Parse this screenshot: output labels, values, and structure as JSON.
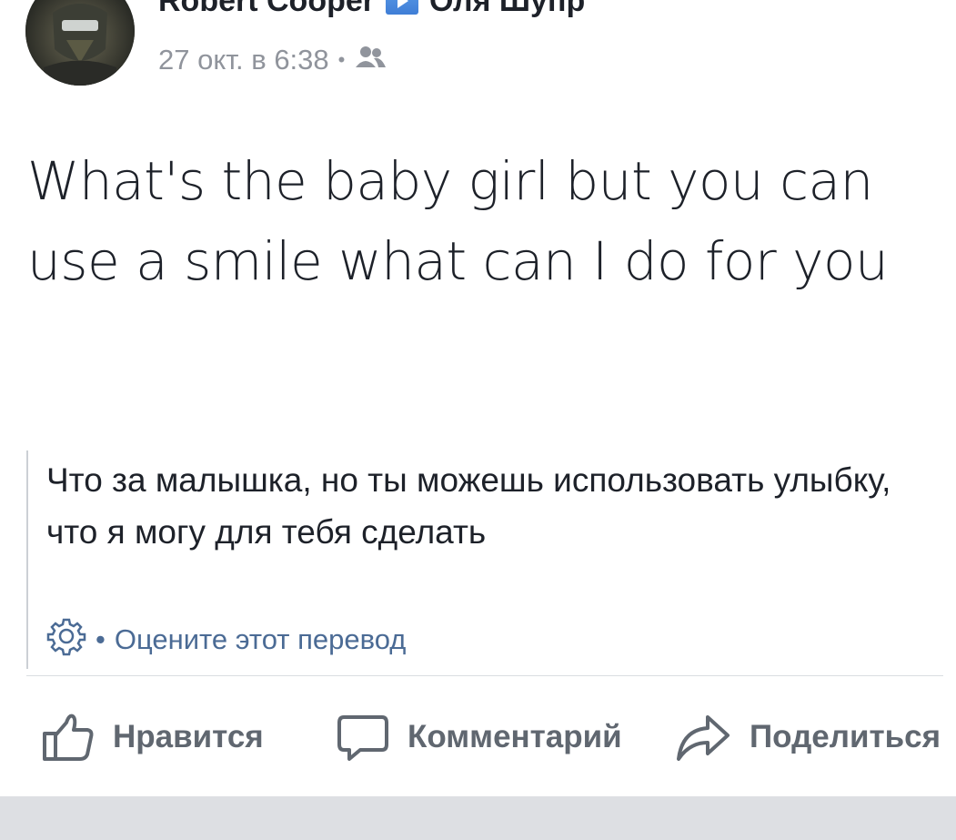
{
  "header": {
    "author": "Robert Cooper",
    "recipient": "Оля Шупр",
    "timestamp": "27 окт. в 6:38",
    "separator": "•",
    "audience_icon": "friends-icon",
    "arrow_icon": "arrow-right-icon",
    "more_icon": "more-icon"
  },
  "post": {
    "text": "What's the baby girl but you can use a smile what can I do for you"
  },
  "translation": {
    "text": "Что за малышка, но ты можешь использовать улыбку, что я могу для тебя сделать",
    "separator": "•",
    "rate_label": "Оцените этот перевод",
    "settings_icon": "gear-icon"
  },
  "actions": {
    "like_label": "Нравится",
    "comment_label": "Комментарий",
    "share_label": "Поделиться",
    "like_icon": "thumbs-up-icon",
    "comment_icon": "comment-icon",
    "share_icon": "share-icon"
  },
  "colors": {
    "text": "#1d2129",
    "meta": "#90949c",
    "link": "#4b6b95",
    "action": "#606770",
    "badge": "#4a8be0",
    "feed_bg": "#dddfe3"
  }
}
